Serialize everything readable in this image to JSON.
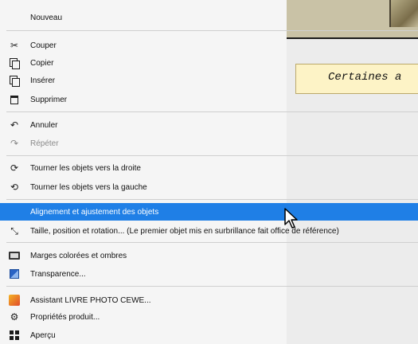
{
  "canvas": {
    "textbox_text": "Certaines a"
  },
  "menu": {
    "items": [
      {
        "label": "Nouveau",
        "icon": ""
      },
      {
        "label": "Couper",
        "icon": "scissors-icon"
      },
      {
        "label": "Copier",
        "icon": "copy-icon"
      },
      {
        "label": "Insérer",
        "icon": "paste-icon"
      },
      {
        "label": "Supprimer",
        "icon": "trash-icon"
      },
      {
        "label": "Annuler",
        "icon": "undo-icon"
      },
      {
        "label": "Répéter",
        "icon": "redo-icon"
      },
      {
        "label": "Tourner les objets vers la droite",
        "icon": "rotate-right-icon"
      },
      {
        "label": "Tourner les objets vers la gauche",
        "icon": "rotate-left-icon"
      },
      {
        "label": "Alignement et ajustement des objets",
        "icon": ""
      },
      {
        "label": "Taille, position et rotation... (Le premier objet mis en surbrillance fait office de référence)",
        "icon": "resize-icon"
      },
      {
        "label": "Marges colorées et ombres",
        "icon": "margins-icon"
      },
      {
        "label": "Transparence...",
        "icon": "transparency-icon"
      },
      {
        "label": "Assistant LIVRE PHOTO CEWE...",
        "icon": "cewe-assistant-icon"
      },
      {
        "label": "Propriétés produit...",
        "icon": "gear-icon"
      },
      {
        "label": "Aperçu",
        "icon": "preview-icon"
      }
    ]
  },
  "colors": {
    "highlight": "#1f7fe6",
    "menu_bg": "#f5f5f5",
    "textbox_bg": "#fdf3c6"
  }
}
